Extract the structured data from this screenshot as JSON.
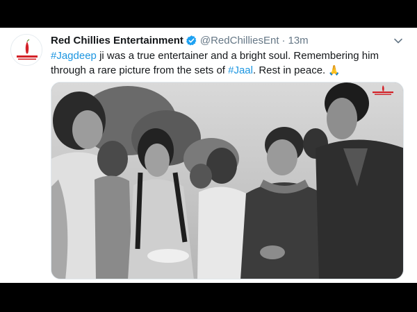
{
  "tweet": {
    "author_name": "Red Chillies Entertainment",
    "handle": "@RedChilliesEnt",
    "separator": "·",
    "time": "13m",
    "text_parts": {
      "tag1": "#Jagdeep",
      "t1": " ji was a true entertainer and a bright soul. Remembering him through a rare picture from the sets of ",
      "tag2": "#Jaal",
      "t2": ". Rest in peace. ",
      "emoji": "🙏"
    },
    "icons": {
      "verified": "verified-badge-icon",
      "caret": "chevron-down-icon",
      "avatar": "red-chillies-logo-icon"
    },
    "colors": {
      "link": "#1b95e0",
      "verified": "#1da1f2",
      "text": "#14171a",
      "muted": "#657786",
      "brand_red": "#d32027"
    }
  }
}
